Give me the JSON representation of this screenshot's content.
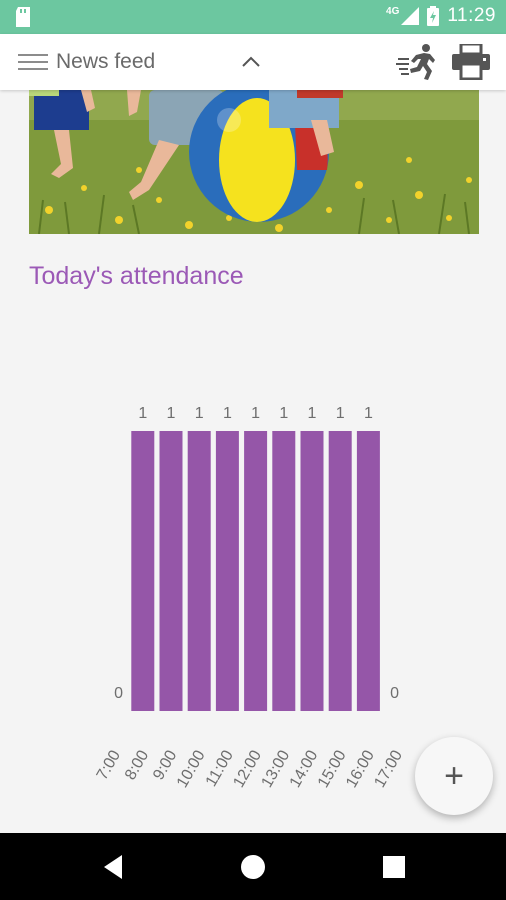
{
  "status": {
    "network": "4G",
    "time": "11:29"
  },
  "appbar": {
    "title": "News feed",
    "menu_icon": "menu-icon",
    "collapse_icon": "chevron-up-icon",
    "action1_icon": "running-person-icon",
    "action2_icon": "print-icon"
  },
  "hero": {
    "image": "children-playing-with-beach-ball-in-meadow"
  },
  "section": {
    "title": "Today's attendance"
  },
  "colors": {
    "accent": "#9b59b6",
    "statusbar": "#6cc7a0",
    "bar": "#9556a8"
  },
  "chart_data": {
    "type": "bar",
    "categories": [
      "7:00",
      "8:00",
      "9:00",
      "10:00",
      "11:00",
      "12:00",
      "13:00",
      "14:00",
      "15:00",
      "16:00",
      "17:00"
    ],
    "values": [
      0,
      1,
      1,
      1,
      1,
      1,
      1,
      1,
      1,
      1,
      0
    ],
    "value_labels": [
      "0",
      "1",
      "1",
      "1",
      "1",
      "1",
      "1",
      "1",
      "1",
      "1",
      "0"
    ],
    "title": "",
    "xlabel": "",
    "ylabel": "",
    "ylim": [
      0,
      1
    ]
  },
  "fab": {
    "label": "+"
  },
  "nav": {
    "back_icon": "back-icon",
    "home_icon": "home-icon",
    "recents_icon": "recents-icon"
  }
}
